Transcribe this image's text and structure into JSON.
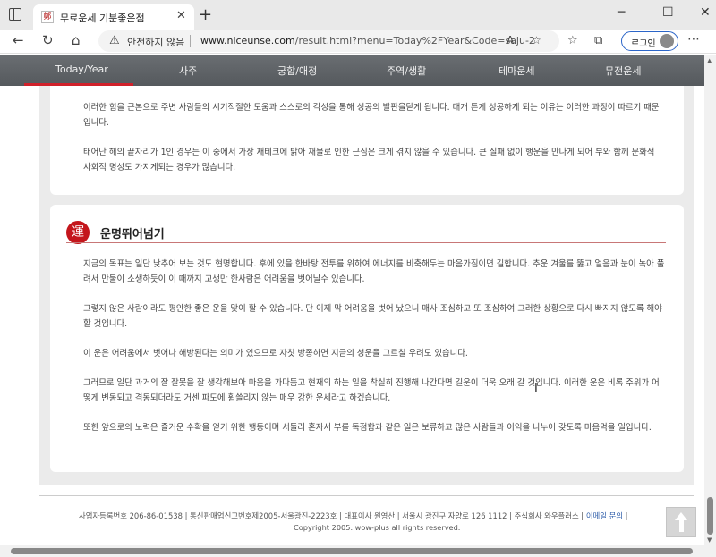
{
  "browser": {
    "tab_title": "무료운세 기분좋은점",
    "favicon_char": "鄭",
    "new_tab": "+",
    "tab_close": "✕",
    "not_secure": "안전하지 않음",
    "url_host": "www.niceunse.com",
    "url_path": "/result.html?menu=Today%2FYear&Code=saju-2",
    "login_label": "로그인"
  },
  "nav": {
    "items": [
      "Today/Year",
      "사주",
      "궁합/애정",
      "주역/생활",
      "테마운세",
      "뮤전운세"
    ],
    "active_index": 0,
    "accent_color": "#d0202a"
  },
  "card1": {
    "paragraphs": [
      "이러한 힘을 근본으로 주변 사람들의 시기적절한 도움과 스스로의 각성을 통해 성공의 발판을닫게 됩니다. 대개 튼게 성공하게 되는 이유는 이러한 과정이 따르기 때문입니다.",
      "태어난 해의 끝자리가 1인 경우는 이 중에서 가장 재테크에 밝아 재물로 인한 근심은 크게 겪지 않을 수 있습니다. 큰 실패 없이 행운을 만나게 되어 부와 함께 문화적 사회적 명성도 가지게되는 경우가 많습니다."
    ]
  },
  "card2": {
    "icon_char": "運",
    "title": "운명뛰어넘기",
    "paragraphs": [
      "지금의 목표는 일단 낮추어 보는 것도 현명합니다. 후에 있을 한바탕 전투를 위하여 에너지를 비축해두는 마음가짐이면 길합니다. 추운 겨울를 뚫고 얼음과 눈이 녹아 풀려서 만물이 소생하듯이 이 때까지 고생만 한사람은 어려움을 벗어날수 있습니다.",
      "그렇지 않은 사람이라도 평안한 좋은 운을 맞이 할 수 있습니다. 단 이제 막 어려움을 벗어 났으니 매사 조심하고 또 조심하여 그러한 상황으로 다시 빠지지 않도록 해야 할 것입니다.",
      "이 운은 어려움에서 벗어나 해방된다는 의미가 있으므로 자칫 방종하면 지금의 성운을 그르칠 우려도 있습니다.",
      "그러므로 일단 과거의 잘 잘못을 잘 생각해보아 마음을 가다듬고 현재의 하는 일을 착실히 진행해 나간다면 길운이 더욱 오래 갈 것입니다. 이러한 운은 비록 주위가 어떻게 변동되고 격동되더라도 거센 파도에 휩쓸리지 않는 매우 강한 운세라고 하겠습니다.",
      "또한 앞으로의 노력은 즐거운 수확을 얻기 위한 행동이며 서둘러 혼자서 부를 독점함과 같은 일은 보류하고 많은 사람들과 이익을 나누어 갖도록 마음먹을 일입니다."
    ]
  },
  "footer": {
    "info": "사업자등록번호 206-86-01538 | 통신판매업신고번호제2005-서울광진-2223호 | 대표이사 원영산 | 서울시 광진구 자양로 126 1112 | 주식회사 와우플러스 |",
    "email_link": "이메일 문의",
    "info_end": "|",
    "copyright": "Copyright 2005. wow-plus all rights reserved."
  },
  "colors": {
    "nav_bg": "#5f6367",
    "section_icon": "#c4161c",
    "content_bg": "#ebebeb"
  }
}
